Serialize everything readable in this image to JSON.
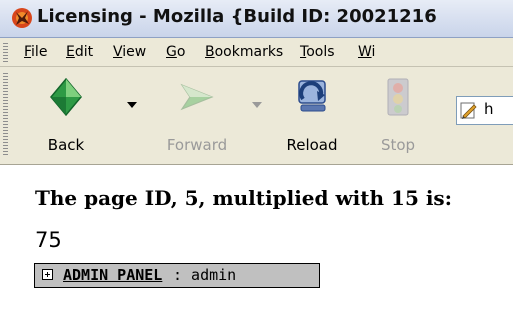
{
  "window": {
    "title": "Licensing - Mozilla {Build ID: 20021216"
  },
  "menu": {
    "items": [
      "File",
      "Edit",
      "View",
      "Go",
      "Bookmarks",
      "Tools",
      "Wi"
    ]
  },
  "toolbar": {
    "back": "Back",
    "forward": "Forward",
    "reload": "Reload",
    "stop": "Stop",
    "url": "h"
  },
  "page": {
    "heading": "The page ID, 5, multiplied with 15 is:",
    "result": "75",
    "admin_panel": {
      "link": "ADMIN PANEL",
      "user": ": admin"
    }
  },
  "colors": {
    "menubar_bg": "#ece9d8",
    "admin_panel_bg": "#c0c0c0"
  }
}
